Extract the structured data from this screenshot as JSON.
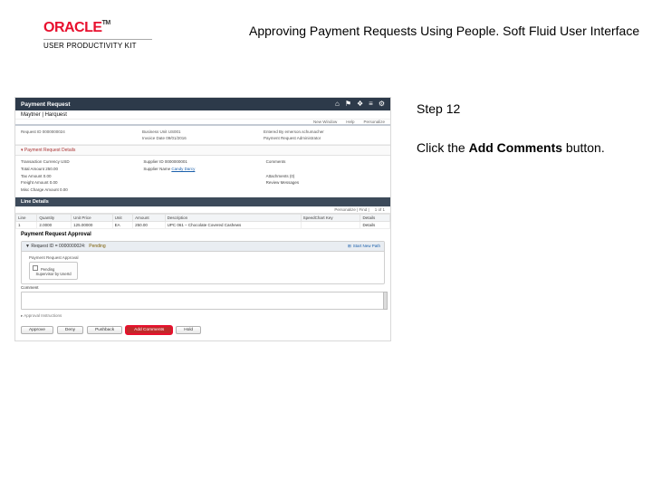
{
  "brand": {
    "logo": "ORACLE",
    "tm": "TM",
    "sub": "USER PRODUCTIVITY KIT"
  },
  "page_title": "Approving Payment Requests Using People. Soft Fluid User Interface",
  "instruction": {
    "step": "Step 12",
    "text_pre": "Click the ",
    "text_bold": "Add Comments",
    "text_post": " button."
  },
  "shot": {
    "title": "Payment Request",
    "crumbs": "Maytner | Harquest",
    "sub_left": "",
    "sub_right1": "New Window",
    "sub_right2": "Help",
    "sub_right3": "Personalize",
    "meta": {
      "c1a": "Request ID 0000000024",
      "c2a": "Business Unit US001",
      "c2b": "Invoice Date 09/01/2016",
      "c3a": "Entered By emerson.schumacher",
      "c3b": "Payment Request Administrator"
    },
    "sect1": "▾ Payment Request Details",
    "details": {
      "d1a": "Transaction Currency USD",
      "d1b": "Total Amount 250.00",
      "d1c": "Tax Amount 0.00",
      "d1d": "Freight Amount 0.00",
      "d1e": "Misc Charge Amount 0.00",
      "d2a": "Supplier ID 0000000001",
      "d2b_lbl": "Supplier Name ",
      "d2b_link": "Candy Darcy",
      "d3a": "Comments",
      "d3b": "Attachments (0)",
      "d3c": "Review Messages"
    },
    "line_hdr": "Line Details",
    "line_sub1": "Personalize | Find |",
    "line_sub2": "1 of 1",
    "tbl": {
      "h1": "Line",
      "h2": "Quantity",
      "h3": "Unit Price",
      "h4": "Unit",
      "h5": "Amount",
      "h6": "Description",
      "h7": "SpeedChart Key",
      "h8": "Details",
      "r1c1": "1",
      "r1c2": "2.0000",
      "r1c3": "125.00000",
      "r1c4": "EA",
      "r1c5": "250.00",
      "r1c6": "UPC 061 – Chocolate Covered Cashews",
      "r1c7": "",
      "r1c8": "Details"
    },
    "appr_hdr": "Payment Request Approval",
    "appr_box_title": "▼ Request ID = 0000000024: ",
    "appr_box_status": "Pending",
    "appr_add": "Start New Path",
    "appr_sub": "Payment Request Approval",
    "appr_step_l1": "Pending",
    "appr_step_l2": "Supervisor by UserId",
    "comment_lbl": "Comment",
    "btn_hint": "▸ Approval Instructions",
    "btn1": "Approve",
    "btn2": "Deny",
    "btn3": "Pushback",
    "btn4": "Add Comments",
    "btn5": "Hold"
  },
  "colors": {
    "accent": "#e8102e",
    "navy": "#2d3a4a"
  }
}
